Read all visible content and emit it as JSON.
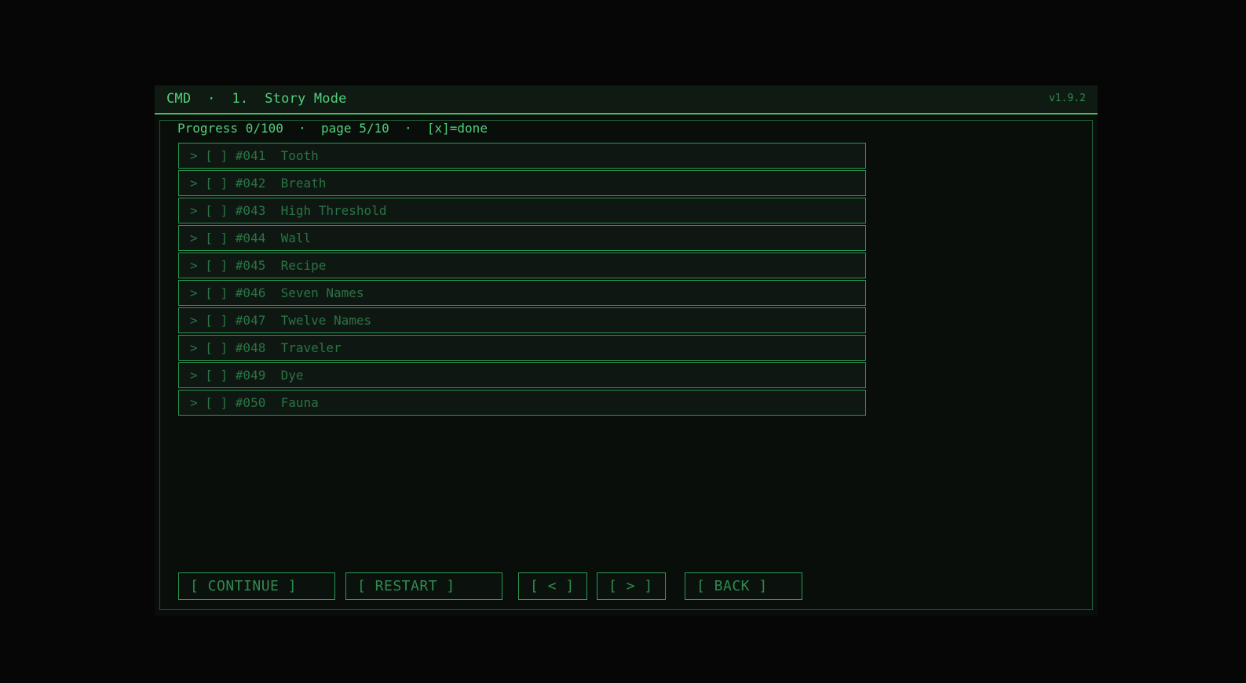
{
  "window": {
    "title": "CMD  ·  1.  Story Mode",
    "version": "v1.9.2"
  },
  "status_line": "Progress 0/100  ·  page 5/10  ·  [x]=done",
  "entries": [
    {
      "text": "> [ ] #041  Tooth"
    },
    {
      "text": "> [ ] #042  Breath"
    },
    {
      "text": "> [ ] #043  High Threshold"
    },
    {
      "text": "> [ ] #044  Wall"
    },
    {
      "text": "> [ ] #045  Recipe"
    },
    {
      "text": "> [ ] #046  Seven Names"
    },
    {
      "text": "> [ ] #047  Twelve Names"
    },
    {
      "text": "> [ ] #048  Traveler"
    },
    {
      "text": "> [ ] #049  Dye"
    },
    {
      "text": "> [ ] #050  Fauna"
    }
  ],
  "buttons": {
    "continue": "[ CONTINUE ]",
    "restart": "[ RESTART ]",
    "prev": "[ < ]",
    "next": "[ > ]",
    "back": "[ BACK ]"
  }
}
